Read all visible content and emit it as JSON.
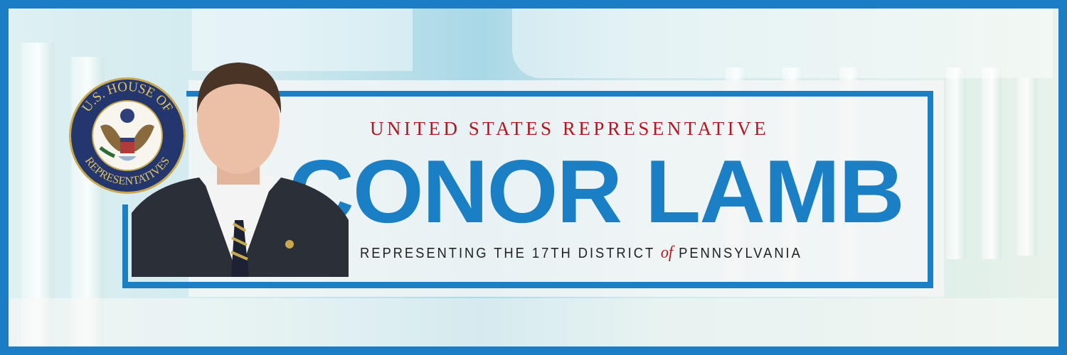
{
  "banner": {
    "subtitle": "UNITED STATES REPRESENTATIVE",
    "name": "CONOR LAMB",
    "district_prefix": "REPRESENTING THE 17TH DISTRICT",
    "district_of": "of",
    "district_suffix": "PENNSYLVANIA"
  },
  "seal": {
    "top_text": "U.S. HOUSE OF",
    "bottom_text": "REPRESENTATIVES"
  },
  "colors": {
    "brand_blue": "#1b7fc6",
    "accent_red": "#b5161e",
    "seal_navy": "#23376e",
    "seal_gold": "#c9a94f"
  }
}
